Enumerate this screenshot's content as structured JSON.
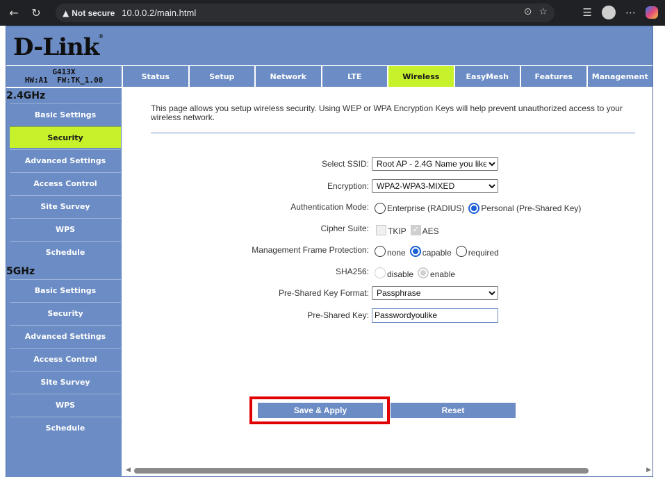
{
  "browser": {
    "back_icon": "←",
    "reload_icon": "↻",
    "not_secure": "Not secure",
    "url": "10.0.0.2/main.html"
  },
  "brand": {
    "logo": "D-Link",
    "reg": "®"
  },
  "device": {
    "model": "G413X",
    "versions": "HW:A1  FW:TK_1.00"
  },
  "tabs": [
    {
      "label": "Status"
    },
    {
      "label": "Setup"
    },
    {
      "label": "Network"
    },
    {
      "label": "LTE"
    },
    {
      "label": "Wireless",
      "active": true
    },
    {
      "label": "EasyMesh"
    },
    {
      "label": "Features"
    },
    {
      "label": "Management"
    }
  ],
  "sidebar": {
    "band_24": "2.4GHz",
    "band_5": "5GHz",
    "items_24": [
      {
        "label": "Basic Settings"
      },
      {
        "label": "Security",
        "active": true
      },
      {
        "label": "Advanced Settings"
      },
      {
        "label": "Access Control"
      },
      {
        "label": "Site Survey"
      },
      {
        "label": "WPS"
      },
      {
        "label": "Schedule"
      }
    ],
    "items_5": [
      {
        "label": "Basic Settings"
      },
      {
        "label": "Security"
      },
      {
        "label": "Advanced Settings"
      },
      {
        "label": "Access Control"
      },
      {
        "label": "Site Survey"
      },
      {
        "label": "WPS"
      },
      {
        "label": "Schedule"
      }
    ]
  },
  "page": {
    "intro": "This page allows you setup wireless security. Using WEP or WPA Encryption Keys will help prevent unauthorized access to your wireless network."
  },
  "form": {
    "ssid_label": "Select SSID:",
    "ssid_value": "Root AP - 2.4G Name you like",
    "encryption_label": "Encryption:",
    "encryption_value": "WPA2-WPA3-MIXED",
    "auth_label": "Authentication Mode:",
    "auth_enterprise": "Enterprise (RADIUS)",
    "auth_personal": "Personal (Pre-Shared Key)",
    "cipher_label": "Cipher Suite:",
    "cipher_tkip": "TKIP",
    "cipher_aes": "AES",
    "mfp_label": "Management Frame Protection:",
    "mfp_none": "none",
    "mfp_capable": "capable",
    "mfp_required": "required",
    "sha_label": "SHA256:",
    "sha_disable": "disable",
    "sha_enable": "enable",
    "psk_format_label": "Pre-Shared Key Format:",
    "psk_format_value": "Passphrase",
    "psk_label": "Pre-Shared Key:",
    "psk_value": "Passwordyoulike"
  },
  "buttons": {
    "save": "Save & Apply",
    "reset": "Reset"
  },
  "colors": {
    "nav_blue": "#6b8cc4",
    "active_green": "#c6f12b",
    "highlight_red": "#e00000"
  }
}
